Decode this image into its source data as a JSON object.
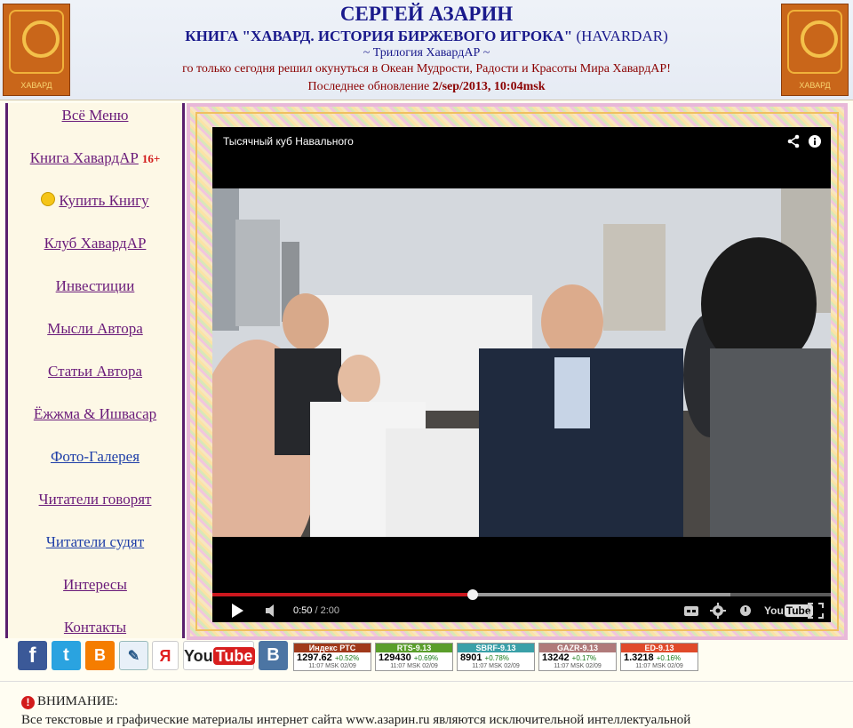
{
  "header": {
    "site_title": "СЕРГЕЙ АЗАРИН",
    "book_title_bold": "КНИГА \"ХАВАРД. ИСТОРИЯ БИРЖЕВОГО ИГРОКА\"",
    "book_title_suffix": "(HAVARDAR)",
    "trilogy": "~ Трилогия ХавардАР ~",
    "tagline": "го только сегодня решил окунуться в Океан Мудрости, Радости и Красоты Мира ХавардАР!",
    "updated_label": "Последнее обновление",
    "updated_value": "2/sep/2013, 10:04msk",
    "logo_text": "ХАВАРД"
  },
  "sidebar": {
    "items": [
      {
        "label": "Всё Меню"
      },
      {
        "label": "Книга ХавардАР",
        "badge": "16+"
      },
      {
        "label": "Купить Книгу"
      },
      {
        "label": "Клуб ХавардАР"
      },
      {
        "label": "Инвестиции"
      },
      {
        "label": "Мысли Автора"
      },
      {
        "label": "Статьи Автора"
      },
      {
        "label": "Ёжжма & Ишвасар"
      },
      {
        "label": "Фото-Галерея"
      },
      {
        "label": "Читатели говорят"
      },
      {
        "label": "Читатели судят"
      },
      {
        "label": "Интересы"
      },
      {
        "label": "Контакты"
      }
    ]
  },
  "video": {
    "title": "Тысячный куб Навального",
    "current_time": "0:50",
    "duration": "/ 2:00",
    "progress": 0.421,
    "buffered": 0.838,
    "brand": "You",
    "brand_tube": "Tube"
  },
  "social": {
    "facebook": "f",
    "twitter": "t",
    "blogger": "B",
    "livejournal": "✎",
    "yandex": "Я",
    "youtube_you": "You",
    "youtube_tube": "Tube",
    "vkontakte": "B"
  },
  "tickers": [
    {
      "name": "Индекс РТС",
      "value": "1297.62",
      "change": "+0.52%",
      "time": "11:07 MSK 02/09",
      "color": "#a0391a"
    },
    {
      "name": "RTS-9.13",
      "value": "129430",
      "change": "+0.69%",
      "time": "11:07 MSK 02/09",
      "color": "#5a9e2a"
    },
    {
      "name": "SBRF-9.13",
      "value": "8901",
      "change": "+0.78%",
      "time": "11:07 MSK 02/09",
      "color": "#3aa0a8"
    },
    {
      "name": "GAZR-9.13",
      "value": "13242",
      "change": "+0.17%",
      "time": "11:07 MSK 02/09",
      "color": "#b07a7a"
    },
    {
      "name": "ED-9.13",
      "value": "1.3218",
      "change": "+0.16%",
      "time": "11:07 MSK 02/09",
      "color": "#e04a2a"
    }
  ],
  "notice": {
    "heading": "ВНИМАНИЕ:",
    "icon": "!",
    "body": "Все текстовые и графические материалы интернет сайта www.азарин.ru являются исключительной интеллектуальной"
  }
}
